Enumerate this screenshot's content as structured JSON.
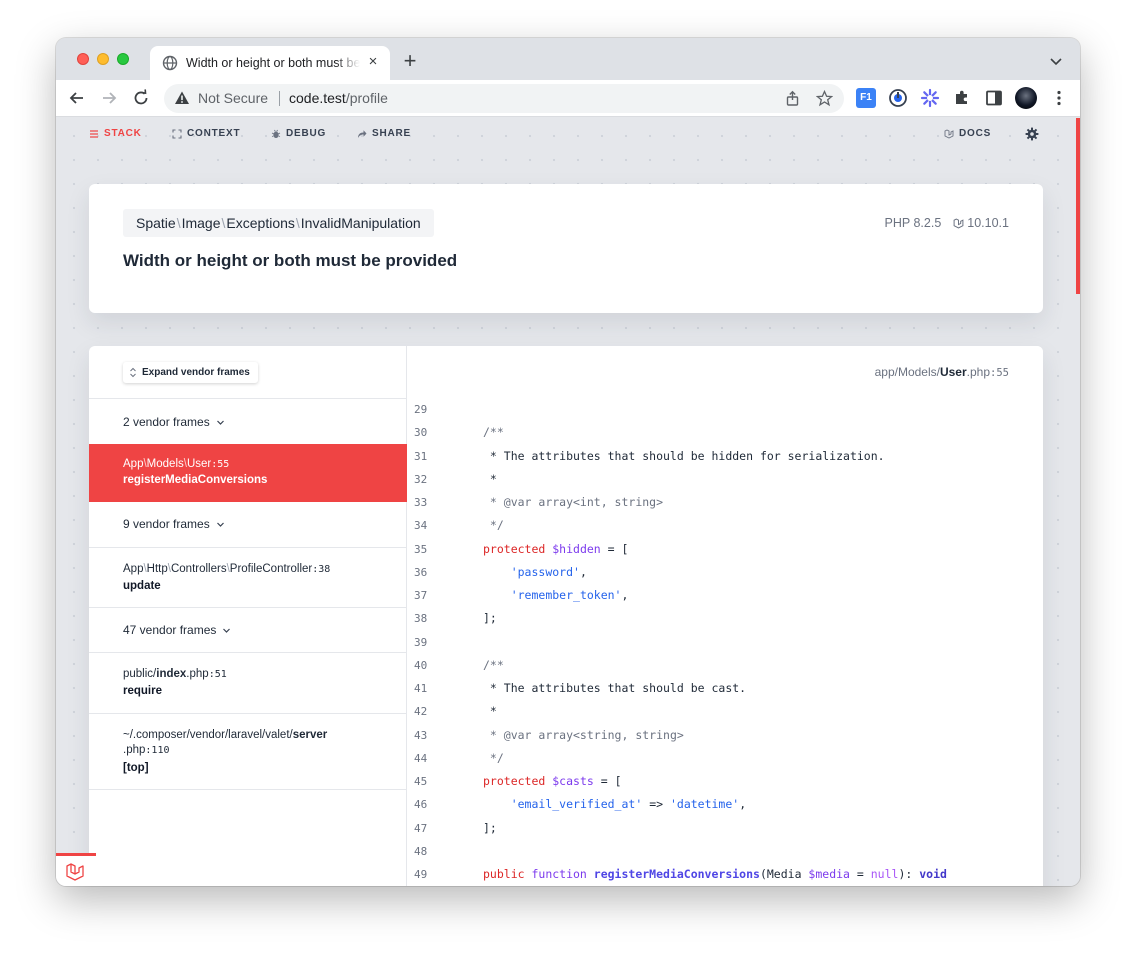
{
  "browser": {
    "tab_title": "Width or height or both must be provided",
    "tab_close": "×",
    "new_tab": "+",
    "security_label": "Not Secure",
    "url_host": "code.test",
    "url_path": "/profile",
    "ext_label": "F1"
  },
  "nav": {
    "items": [
      {
        "label": "STACK",
        "active": true
      },
      {
        "label": "CONTEXT"
      },
      {
        "label": "DEBUG"
      },
      {
        "label": "SHARE"
      }
    ],
    "docs": "DOCS"
  },
  "exception": {
    "class_parts": [
      "Spatie",
      "Image",
      "Exceptions",
      "InvalidManipulation"
    ],
    "message": "Width or height or both must be provided",
    "php_version": "PHP 8.2.5",
    "laravel_version": "10.10.1"
  },
  "stack": {
    "expand_label": "Expand vendor frames",
    "frames": [
      {
        "kind": "vendor",
        "label": "2 vendor frames"
      },
      {
        "kind": "app",
        "selected": true,
        "class_parts": [
          "App",
          "Models",
          "User"
        ],
        "line": "55",
        "method": "registerMediaConversions"
      },
      {
        "kind": "vendor",
        "label": "9 vendor frames"
      },
      {
        "kind": "app",
        "class_parts": [
          "App",
          "Http",
          "Controllers",
          "ProfileController"
        ],
        "line": "38",
        "method": "update"
      },
      {
        "kind": "vendor",
        "label": "47 vendor frames"
      },
      {
        "kind": "app",
        "path_prefix": "public/",
        "path_bold": "index",
        "path_ext": ".php",
        "line": "51",
        "method": "require"
      },
      {
        "kind": "app",
        "path_prefix": "~/.composer/vendor/laravel/valet/",
        "path_bold": "server",
        "path_ext": ".php",
        "line": "110",
        "method": "[top]"
      }
    ]
  },
  "code": {
    "file_prefix": "app/Models/",
    "file_bold": "User",
    "file_ext": ".php",
    "file_line": "55",
    "lines": [
      {
        "n": "29",
        "t": []
      },
      {
        "n": "30",
        "t": [
          [
            "cm",
            "/**"
          ]
        ]
      },
      {
        "n": "31",
        "t": [
          [
            "plain",
            " * The attributes that should be hidden for serialization."
          ]
        ]
      },
      {
        "n": "32",
        "t": [
          [
            "plain",
            " *"
          ]
        ]
      },
      {
        "n": "33",
        "t": [
          [
            "cm",
            " * @var "
          ],
          [
            "cm",
            "array<int, string>"
          ]
        ]
      },
      {
        "n": "34",
        "t": [
          [
            "cm",
            " */"
          ]
        ]
      },
      {
        "n": "35",
        "t": [
          [
            "kw",
            "protected "
          ],
          [
            "var",
            "$hidden"
          ],
          [
            "plain",
            " = ["
          ]
        ]
      },
      {
        "n": "36",
        "t": [
          [
            "plain",
            "    "
          ],
          [
            "str",
            "'password'"
          ],
          [
            "plain",
            ","
          ]
        ]
      },
      {
        "n": "37",
        "t": [
          [
            "plain",
            "    "
          ],
          [
            "str",
            "'remember_token'"
          ],
          [
            "plain",
            ","
          ]
        ]
      },
      {
        "n": "38",
        "t": [
          [
            "plain",
            "];"
          ]
        ]
      },
      {
        "n": "39",
        "t": []
      },
      {
        "n": "40",
        "t": [
          [
            "cm",
            "/**"
          ]
        ]
      },
      {
        "n": "41",
        "t": [
          [
            "plain",
            " * The attributes that should be cast."
          ]
        ]
      },
      {
        "n": "42",
        "t": [
          [
            "plain",
            " *"
          ]
        ]
      },
      {
        "n": "43",
        "t": [
          [
            "cm",
            " * @var "
          ],
          [
            "cm",
            "array<string, string>"
          ]
        ]
      },
      {
        "n": "44",
        "t": [
          [
            "cm",
            " */"
          ]
        ]
      },
      {
        "n": "45",
        "t": [
          [
            "kw",
            "protected "
          ],
          [
            "var",
            "$casts"
          ],
          [
            "plain",
            " = ["
          ]
        ]
      },
      {
        "n": "46",
        "t": [
          [
            "plain",
            "    "
          ],
          [
            "str",
            "'email_verified_at'"
          ],
          [
            "plain",
            " => "
          ],
          [
            "str",
            "'datetime'"
          ],
          [
            "plain",
            ","
          ]
        ]
      },
      {
        "n": "47",
        "t": [
          [
            "plain",
            "];"
          ]
        ]
      },
      {
        "n": "48",
        "t": []
      },
      {
        "n": "49",
        "t": [
          [
            "kw",
            "public "
          ],
          [
            "var",
            "function "
          ],
          [
            "fn",
            "registerMediaConversions"
          ],
          [
            "plain",
            "(Media "
          ],
          [
            "var",
            "$media"
          ],
          [
            "plain",
            " = "
          ],
          [
            "null",
            "null"
          ],
          [
            "plain",
            "): "
          ],
          [
            "type",
            "void"
          ]
        ]
      }
    ]
  },
  "colors": {
    "accent": "#ef4444",
    "page_bg": "#e5e7eb"
  }
}
